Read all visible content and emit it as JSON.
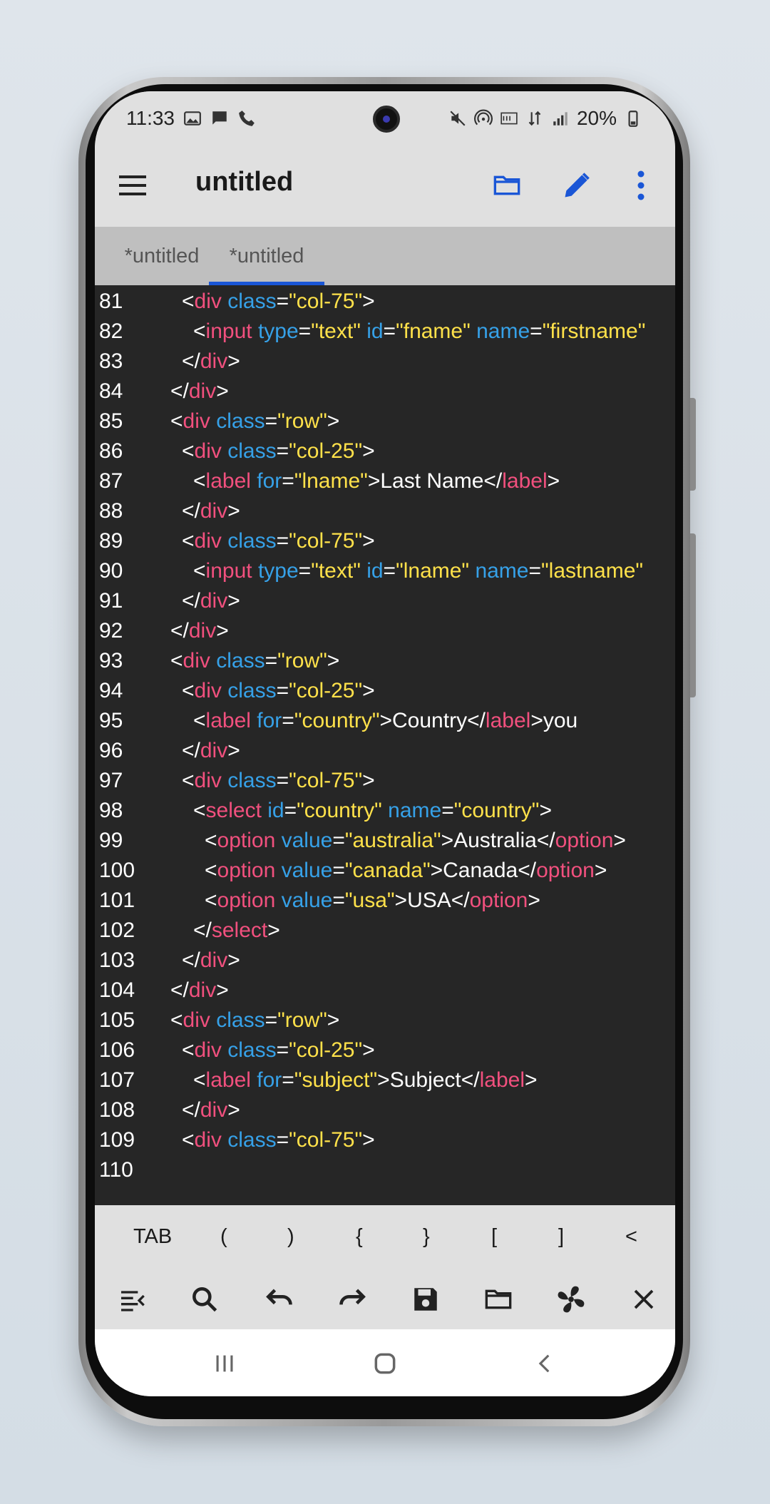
{
  "status": {
    "time": "11:33",
    "battery": "20%"
  },
  "appbar": {
    "title": "untitled"
  },
  "tabs": [
    {
      "label": "*untitled",
      "active": false
    },
    {
      "label": "*untitled",
      "active": true
    }
  ],
  "editor": {
    "lines": [
      {
        "n": "81",
        "indent": 1,
        "tokens": [
          [
            "p",
            "<"
          ],
          [
            "t",
            "div"
          ],
          [
            "p",
            " "
          ],
          [
            "a",
            "class"
          ],
          [
            "p",
            "="
          ],
          [
            "s",
            "\"col-75\""
          ],
          [
            "p",
            ">"
          ]
        ]
      },
      {
        "n": "82",
        "indent": 2,
        "tokens": [
          [
            "p",
            "<"
          ],
          [
            "t",
            "input"
          ],
          [
            "p",
            " "
          ],
          [
            "a",
            "type"
          ],
          [
            "p",
            "="
          ],
          [
            "s",
            "\"text\""
          ],
          [
            "p",
            " "
          ],
          [
            "a",
            "id"
          ],
          [
            "p",
            "="
          ],
          [
            "s",
            "\"fname\""
          ],
          [
            "p",
            " "
          ],
          [
            "a",
            "name"
          ],
          [
            "p",
            "="
          ],
          [
            "s",
            "\"firstname\""
          ]
        ]
      },
      {
        "n": "83",
        "indent": 1,
        "tokens": [
          [
            "p",
            "</"
          ],
          [
            "t",
            "div"
          ],
          [
            "p",
            ">"
          ]
        ]
      },
      {
        "n": "84",
        "indent": 0,
        "tokens": [
          [
            "p",
            "</"
          ],
          [
            "t",
            "div"
          ],
          [
            "p",
            ">"
          ]
        ]
      },
      {
        "n": "85",
        "indent": 0,
        "tokens": [
          [
            "p",
            "<"
          ],
          [
            "t",
            "div"
          ],
          [
            "p",
            " "
          ],
          [
            "a",
            "class"
          ],
          [
            "p",
            "="
          ],
          [
            "s",
            "\"row\""
          ],
          [
            "p",
            ">"
          ]
        ]
      },
      {
        "n": "86",
        "indent": 1,
        "tokens": [
          [
            "p",
            "<"
          ],
          [
            "t",
            "div"
          ],
          [
            "p",
            " "
          ],
          [
            "a",
            "class"
          ],
          [
            "p",
            "="
          ],
          [
            "s",
            "\"col-25\""
          ],
          [
            "p",
            ">"
          ]
        ]
      },
      {
        "n": "87",
        "indent": 2,
        "tokens": [
          [
            "p",
            "<"
          ],
          [
            "t",
            "label"
          ],
          [
            "p",
            " "
          ],
          [
            "a",
            "for"
          ],
          [
            "p",
            "="
          ],
          [
            "s",
            "\"lname\""
          ],
          [
            "p",
            ">Last Name</"
          ],
          [
            "t",
            "label"
          ],
          [
            "p",
            ">"
          ]
        ]
      },
      {
        "n": "88",
        "indent": 1,
        "tokens": [
          [
            "p",
            "</"
          ],
          [
            "t",
            "div"
          ],
          [
            "p",
            ">"
          ]
        ]
      },
      {
        "n": "89",
        "indent": 1,
        "tokens": [
          [
            "p",
            "<"
          ],
          [
            "t",
            "div"
          ],
          [
            "p",
            " "
          ],
          [
            "a",
            "class"
          ],
          [
            "p",
            "="
          ],
          [
            "s",
            "\"col-75\""
          ],
          [
            "p",
            ">"
          ]
        ]
      },
      {
        "n": "90",
        "indent": 2,
        "tokens": [
          [
            "p",
            "<"
          ],
          [
            "t",
            "input"
          ],
          [
            "p",
            " "
          ],
          [
            "a",
            "type"
          ],
          [
            "p",
            "="
          ],
          [
            "s",
            "\"text\""
          ],
          [
            "p",
            " "
          ],
          [
            "a",
            "id"
          ],
          [
            "p",
            "="
          ],
          [
            "s",
            "\"lname\""
          ],
          [
            "p",
            " "
          ],
          [
            "a",
            "name"
          ],
          [
            "p",
            "="
          ],
          [
            "s",
            "\"lastname\""
          ]
        ]
      },
      {
        "n": "91",
        "indent": 1,
        "tokens": [
          [
            "p",
            "</"
          ],
          [
            "t",
            "div"
          ],
          [
            "p",
            ">"
          ]
        ]
      },
      {
        "n": "92",
        "indent": 0,
        "tokens": [
          [
            "p",
            "</"
          ],
          [
            "t",
            "div"
          ],
          [
            "p",
            ">"
          ]
        ]
      },
      {
        "n": "93",
        "indent": 0,
        "tokens": [
          [
            "p",
            "<"
          ],
          [
            "t",
            "div"
          ],
          [
            "p",
            " "
          ],
          [
            "a",
            "class"
          ],
          [
            "p",
            "="
          ],
          [
            "s",
            "\"row\""
          ],
          [
            "p",
            ">"
          ]
        ]
      },
      {
        "n": "94",
        "indent": 1,
        "tokens": [
          [
            "p",
            "<"
          ],
          [
            "t",
            "div"
          ],
          [
            "p",
            " "
          ],
          [
            "a",
            "class"
          ],
          [
            "p",
            "="
          ],
          [
            "s",
            "\"col-25\""
          ],
          [
            "p",
            ">"
          ]
        ]
      },
      {
        "n": "95",
        "indent": 2,
        "tokens": [
          [
            "p",
            "<"
          ],
          [
            "t",
            "label"
          ],
          [
            "p",
            " "
          ],
          [
            "a",
            "for"
          ],
          [
            "p",
            "="
          ],
          [
            "s",
            "\"country\""
          ],
          [
            "p",
            ">Country</"
          ],
          [
            "t",
            "label"
          ],
          [
            "p",
            ">you"
          ]
        ]
      },
      {
        "n": "96",
        "indent": 1,
        "tokens": [
          [
            "p",
            "</"
          ],
          [
            "t",
            "div"
          ],
          [
            "p",
            ">"
          ]
        ]
      },
      {
        "n": "97",
        "indent": 1,
        "tokens": [
          [
            "p",
            "<"
          ],
          [
            "t",
            "div"
          ],
          [
            "p",
            " "
          ],
          [
            "a",
            "class"
          ],
          [
            "p",
            "="
          ],
          [
            "s",
            "\"col-75\""
          ],
          [
            "p",
            ">"
          ]
        ]
      },
      {
        "n": "98",
        "indent": 2,
        "tokens": [
          [
            "p",
            "<"
          ],
          [
            "t",
            "select"
          ],
          [
            "p",
            " "
          ],
          [
            "a",
            "id"
          ],
          [
            "p",
            "="
          ],
          [
            "s",
            "\"country\""
          ],
          [
            "p",
            " "
          ],
          [
            "a",
            "name"
          ],
          [
            "p",
            "="
          ],
          [
            "s",
            "\"country\""
          ],
          [
            "p",
            ">"
          ]
        ]
      },
      {
        "n": "99",
        "indent": 3,
        "tokens": [
          [
            "p",
            "<"
          ],
          [
            "t",
            "option"
          ],
          [
            "p",
            " "
          ],
          [
            "a",
            "value"
          ],
          [
            "p",
            "="
          ],
          [
            "s",
            "\"australia\""
          ],
          [
            "p",
            ">Australia</"
          ],
          [
            "t",
            "option"
          ],
          [
            "p",
            ">"
          ]
        ]
      },
      {
        "n": "100",
        "indent": 3,
        "tokens": [
          [
            "p",
            "<"
          ],
          [
            "t",
            "option"
          ],
          [
            "p",
            " "
          ],
          [
            "a",
            "value"
          ],
          [
            "p",
            "="
          ],
          [
            "s",
            "\"canada\""
          ],
          [
            "p",
            ">Canada</"
          ],
          [
            "t",
            "option"
          ],
          [
            "p",
            ">"
          ]
        ]
      },
      {
        "n": "101",
        "indent": 3,
        "tokens": [
          [
            "p",
            "<"
          ],
          [
            "t",
            "option"
          ],
          [
            "p",
            " "
          ],
          [
            "a",
            "value"
          ],
          [
            "p",
            "="
          ],
          [
            "s",
            "\"usa\""
          ],
          [
            "p",
            ">USA</"
          ],
          [
            "t",
            "option"
          ],
          [
            "p",
            ">"
          ]
        ]
      },
      {
        "n": "102",
        "indent": 2,
        "tokens": [
          [
            "p",
            "</"
          ],
          [
            "t",
            "select"
          ],
          [
            "p",
            ">"
          ]
        ]
      },
      {
        "n": "103",
        "indent": 1,
        "tokens": [
          [
            "p",
            "</"
          ],
          [
            "t",
            "div"
          ],
          [
            "p",
            ">"
          ]
        ]
      },
      {
        "n": "104",
        "indent": 0,
        "tokens": [
          [
            "p",
            "</"
          ],
          [
            "t",
            "div"
          ],
          [
            "p",
            ">"
          ]
        ]
      },
      {
        "n": "105",
        "indent": 0,
        "tokens": [
          [
            "p",
            "<"
          ],
          [
            "t",
            "div"
          ],
          [
            "p",
            " "
          ],
          [
            "a",
            "class"
          ],
          [
            "p",
            "="
          ],
          [
            "s",
            "\"row\""
          ],
          [
            "p",
            ">"
          ]
        ]
      },
      {
        "n": "106",
        "indent": 1,
        "tokens": [
          [
            "p",
            "<"
          ],
          [
            "t",
            "div"
          ],
          [
            "p",
            " "
          ],
          [
            "a",
            "class"
          ],
          [
            "p",
            "="
          ],
          [
            "s",
            "\"col-25\""
          ],
          [
            "p",
            ">"
          ]
        ]
      },
      {
        "n": "107",
        "indent": 2,
        "tokens": [
          [
            "p",
            "<"
          ],
          [
            "t",
            "label"
          ],
          [
            "p",
            " "
          ],
          [
            "a",
            "for"
          ],
          [
            "p",
            "="
          ],
          [
            "s",
            "\"subject\""
          ],
          [
            "p",
            ">Subject</"
          ],
          [
            "t",
            "label"
          ],
          [
            "p",
            ">"
          ]
        ]
      },
      {
        "n": "108",
        "indent": 1,
        "tokens": [
          [
            "p",
            "</"
          ],
          [
            "t",
            "div"
          ],
          [
            "p",
            ">"
          ]
        ]
      },
      {
        "n": "109",
        "indent": 1,
        "tokens": [
          [
            "p",
            "<"
          ],
          [
            "t",
            "div"
          ],
          [
            "p",
            " "
          ],
          [
            "a",
            "class"
          ],
          [
            "p",
            "="
          ],
          [
            "s",
            "\"col-75\""
          ],
          [
            "p",
            ">"
          ]
        ]
      },
      {
        "n": "110",
        "indent": 0,
        "tokens": []
      }
    ]
  },
  "symbol_keys": [
    "TAB",
    "(",
    ")",
    "{",
    "}",
    "[",
    "]",
    "<"
  ],
  "toolbar_icons": [
    "wrap-lines-icon",
    "search-icon",
    "undo-icon",
    "redo-icon",
    "save-icon",
    "folder-icon",
    "fan-icon",
    "close-icon"
  ],
  "colors": {
    "tag": "#f1507e",
    "attribute": "#36a1e8",
    "string": "#ffe14a",
    "text": "#ffffff",
    "editor_bg": "#262626",
    "accent": "#1a56d6"
  }
}
